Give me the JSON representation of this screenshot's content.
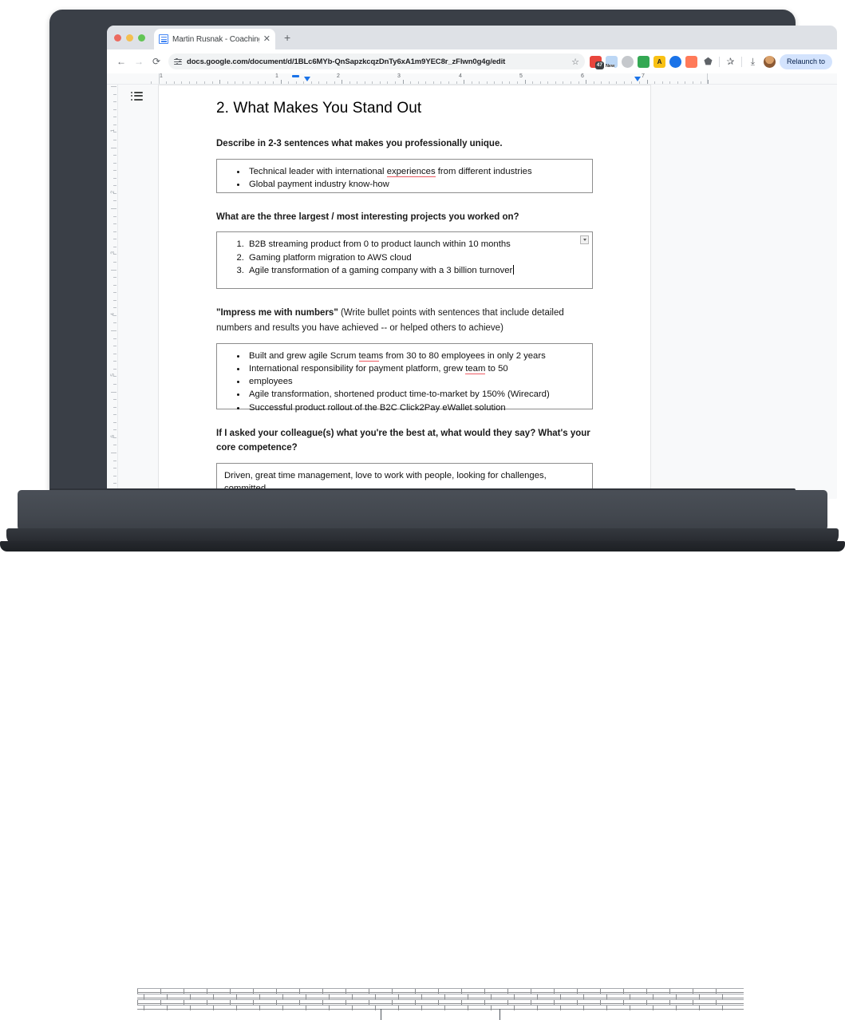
{
  "browser": {
    "tab": {
      "title": "Martin Rusnak - Coaching Wo",
      "close_label": "✕",
      "favicon_name": "google-docs-favicon"
    },
    "new_tab_label": "+",
    "nav": {
      "back": "←",
      "forward": "→",
      "reload": "⟳"
    },
    "omnibox": {
      "url": "docs.google.com/document/d/1BLc6MYb-QnSapzkcqzDnTy6xA1m9YEC8r_zFlwn0g4g/edit",
      "bookmark_star": "☆"
    },
    "extensions": [
      {
        "name": "extension-red-counter",
        "color": "#e8453c",
        "badge": "47",
        "glyph": ""
      },
      {
        "name": "extension-new-label",
        "color": "#dbeafe",
        "badge": "New",
        "glyph": ""
      },
      {
        "name": "extension-gray-circle",
        "color": "#c5c8cc",
        "badge": "",
        "glyph": ""
      },
      {
        "name": "extension-green-box",
        "color": "#34a853",
        "badge": "",
        "glyph": ""
      },
      {
        "name": "extension-yellow-triangle",
        "color": "#f9c114",
        "badge": "",
        "glyph": "A"
      },
      {
        "name": "extension-blue-circle",
        "color": "#1a73e8",
        "badge": "",
        "glyph": ""
      },
      {
        "name": "extension-orange-hubspot",
        "color": "#ff7a59",
        "badge": "",
        "glyph": "ƒ"
      }
    ],
    "toolbar_right": {
      "extensions_puzzle": "⬟",
      "bookmark_star": "✰",
      "downloads": "⤓",
      "avatar_name": "user-avatar",
      "relaunch_label": "Relaunch to"
    }
  },
  "docs": {
    "outline_button_name": "document-outline-toggle",
    "ruler": {
      "horizontal_numbers": [
        "1",
        "1",
        "2",
        "3",
        "4",
        "5",
        "6",
        "7"
      ],
      "vertical_numbers": [
        "1",
        "2",
        "3",
        "4",
        "5",
        "6"
      ]
    },
    "document": {
      "heading": "2. What Makes You Stand Out",
      "sections": [
        {
          "name": "section-unique",
          "question": "Describe in 2-3 sentences what makes you professionally unique.",
          "question_bold_part": "",
          "list_type": "bullet",
          "items": [
            "Technical leader with international experiences from different industries",
            "Global payment industry know-how"
          ],
          "misspelled": [
            "experiences"
          ],
          "has_widget": false
        },
        {
          "name": "section-projects",
          "question": "What are the three largest / most interesting projects you worked on?",
          "list_type": "number",
          "items": [
            "B2B streaming product from 0 to product launch within 10 months",
            "Gaming platform migration to AWS cloud",
            "Agile transformation of a gaming company with a 3 billion turnover"
          ],
          "misspelled": [],
          "has_widget": true,
          "caret_after_last": true
        },
        {
          "name": "section-numbers",
          "question_bold": "\"Impress me with numbers\"",
          "question_rest": " (Write bullet points with sentences that include detailed numbers and results you have achieved -- or helped others to achieve)",
          "list_type": "bullet",
          "items": [
            "Built and grew agile Scrum teams from 30 to 80 employees in only 2 years",
            "International responsibility for payment platform, grew team to 50",
            "employees",
            "Agile transformation, shortened product time-to-market by 150% (Wirecard)",
            "Successful product rollout of the B2C Click2Pay eWallet solution"
          ],
          "misspelled": [
            "team"
          ],
          "has_widget": false
        },
        {
          "name": "section-competence",
          "question": "If I asked your colleague(s) what you're the best at, what would they say? What's your core competence?",
          "list_type": "paragraph",
          "items": [
            "Driven, great time management, love to work with people, looking for challenges, committed"
          ],
          "misspelled": [],
          "has_widget": false
        }
      ]
    }
  },
  "colors": {
    "accent": "#1a73e8",
    "spellcheck": "#ee5b63",
    "relaunch_pill": "#d3e3fd"
  }
}
